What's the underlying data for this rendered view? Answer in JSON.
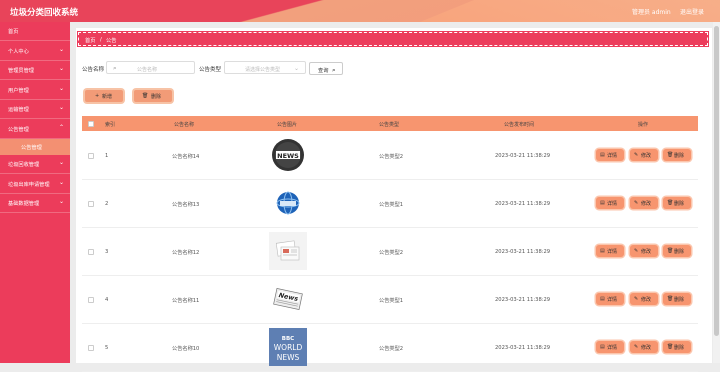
{
  "header": {
    "title": "垃圾分类回收系统",
    "user_label": "管理员 admin",
    "logout_label": "退出登录"
  },
  "sidebar": {
    "items": [
      {
        "label": "首页",
        "has_arrow": false
      },
      {
        "label": "个人中心",
        "has_arrow": true
      },
      {
        "label": "管理员管理",
        "has_arrow": true
      },
      {
        "label": "用户管理",
        "has_arrow": true
      },
      {
        "label": "运输管理",
        "has_arrow": true
      },
      {
        "label": "公告管理",
        "has_arrow": true
      },
      {
        "label": "垃圾回收管理",
        "has_arrow": true
      },
      {
        "label": "垃圾出库申请管理",
        "has_arrow": true
      },
      {
        "label": "基础数据管理",
        "has_arrow": true
      }
    ],
    "active_sub": "公告管理"
  },
  "breadcrumb": {
    "home": "首页",
    "sep": "/",
    "current": "公告"
  },
  "filters": {
    "name_label": "公告名称",
    "name_placeholder": "公告名称",
    "type_label": "公告类型",
    "type_placeholder": "请选择公告类型",
    "search_label": "查询"
  },
  "actions": {
    "add_label": "新增",
    "delete_label": "删除"
  },
  "table": {
    "headers": [
      "索引",
      "公告名称",
      "公告图片",
      "公告类型",
      "公告发布时间",
      "操作"
    ],
    "rows": [
      {
        "index": "1",
        "name": "公告名称14",
        "image": "news-black-badge",
        "type": "公告类型2",
        "time": "2023-03-21 11:38:29"
      },
      {
        "index": "2",
        "name": "公告名称13",
        "image": "news-globe",
        "type": "公告类型1",
        "time": "2023-03-21 11:38:29"
      },
      {
        "index": "3",
        "name": "公告名称12",
        "image": "newspaper-papers",
        "type": "公告类型2",
        "time": "2023-03-21 11:38:29"
      },
      {
        "index": "4",
        "name": "公告名称11",
        "image": "news-paper-stack",
        "type": "公告类型1",
        "time": "2023-03-21 11:38:29"
      },
      {
        "index": "5",
        "name": "公告名称10",
        "image": "bbc-world-news",
        "type": "公告类型2",
        "time": "2023-03-21 11:38:29"
      }
    ],
    "row_buttons": {
      "detail": "详情",
      "edit": "修改",
      "delete": "删除"
    },
    "image5_texts": [
      "BBC",
      "WORLD",
      "NEWS"
    ],
    "image1_text": "NEWS",
    "image4_text": "News"
  },
  "colors": {
    "primary": "#ec3c5b",
    "accent": "#f7956f"
  }
}
